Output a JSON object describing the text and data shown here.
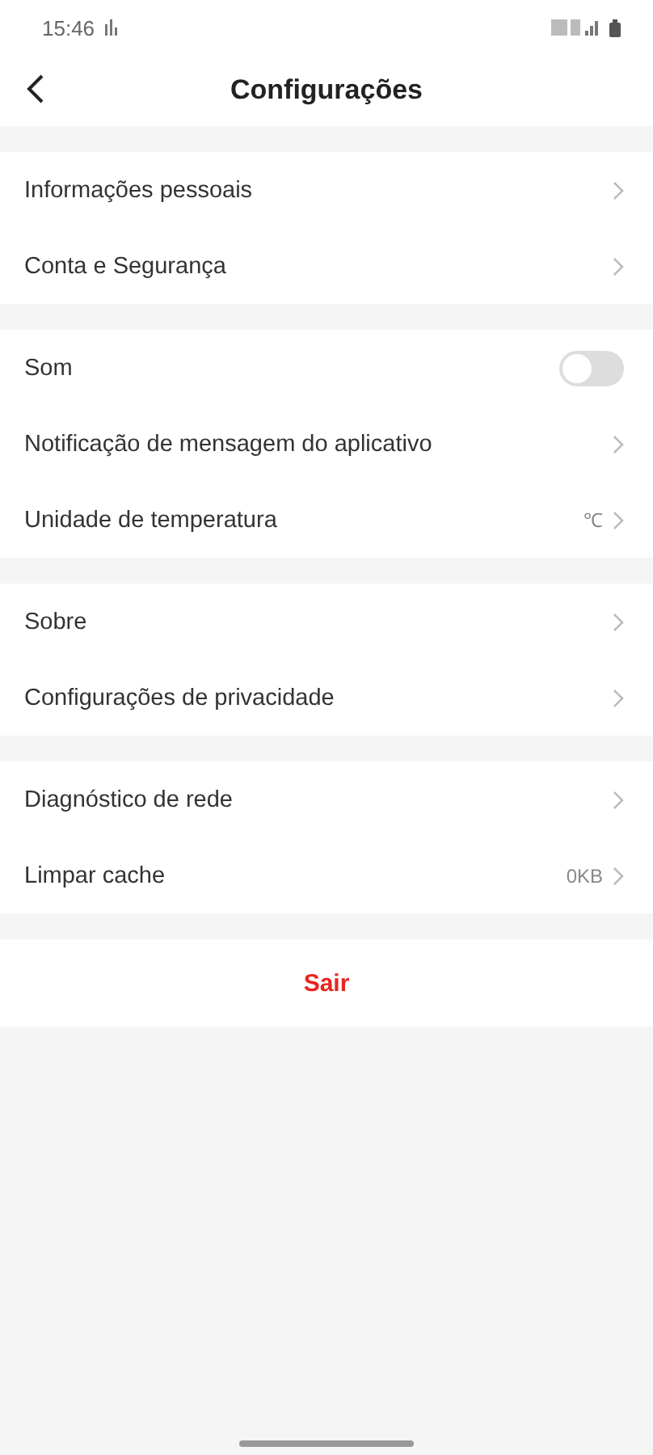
{
  "status_bar": {
    "time": "15:46"
  },
  "header": {
    "title": "Configurações"
  },
  "groups": [
    {
      "rows": [
        {
          "kind": "link",
          "label": "Informações pessoais"
        },
        {
          "kind": "link",
          "label": "Conta e Segurança"
        }
      ]
    },
    {
      "rows": [
        {
          "kind": "toggle",
          "label": "Som",
          "on": false
        },
        {
          "kind": "link",
          "label": "Notificação de mensagem do aplicativo"
        },
        {
          "kind": "link",
          "label": "Unidade de temperatura",
          "value": "℃"
        }
      ]
    },
    {
      "rows": [
        {
          "kind": "link",
          "label": "Sobre"
        },
        {
          "kind": "link",
          "label": "Configurações de privacidade"
        }
      ]
    },
    {
      "rows": [
        {
          "kind": "link",
          "label": "Diagnóstico de rede"
        },
        {
          "kind": "link",
          "label": "Limpar cache",
          "value": "0KB"
        }
      ]
    }
  ],
  "logout": {
    "label": "Sair"
  }
}
